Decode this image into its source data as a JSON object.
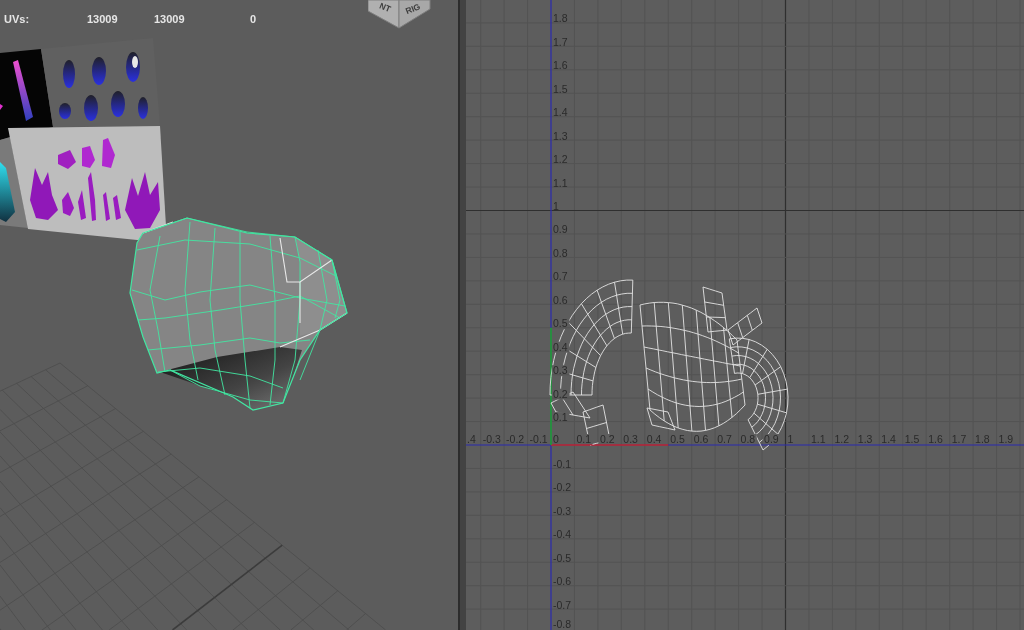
{
  "viewport": {
    "hud": {
      "rows": [
        {
          "label": "UVs:",
          "values": [
            "13009",
            "13009",
            "0"
          ]
        }
      ]
    },
    "view_cube": {
      "faces": [
        "NT",
        "RIG"
      ]
    }
  },
  "uv_editor": {
    "u_labels": [
      ".4",
      "-0.3",
      "-0.2",
      "-0.1",
      "0",
      "0.1",
      "0.2",
      "0.3",
      "0.4",
      "0.5",
      "0.6",
      "0.7",
      "0.8",
      "0.9",
      "1",
      "1.1",
      "1.2",
      "1.3",
      "1.4",
      "1.5",
      "1.6",
      "1.7",
      "1.8",
      "1.9"
    ],
    "v_labels_positive": [
      "1.8",
      "1.7",
      "1.6",
      "1.5",
      "1.4",
      "1.3",
      "1.2",
      "1.1",
      "1",
      "0.9",
      "0.8",
      "0.7",
      "0.6",
      "0.5",
      "0.4",
      "0.3",
      "0.2",
      "0.1"
    ],
    "v_labels_negative": [
      "-0.1",
      "-0.2",
      "-0.3",
      "-0.4",
      "-0.5",
      "-0.6",
      "-0.7",
      "-0.8"
    ]
  }
}
